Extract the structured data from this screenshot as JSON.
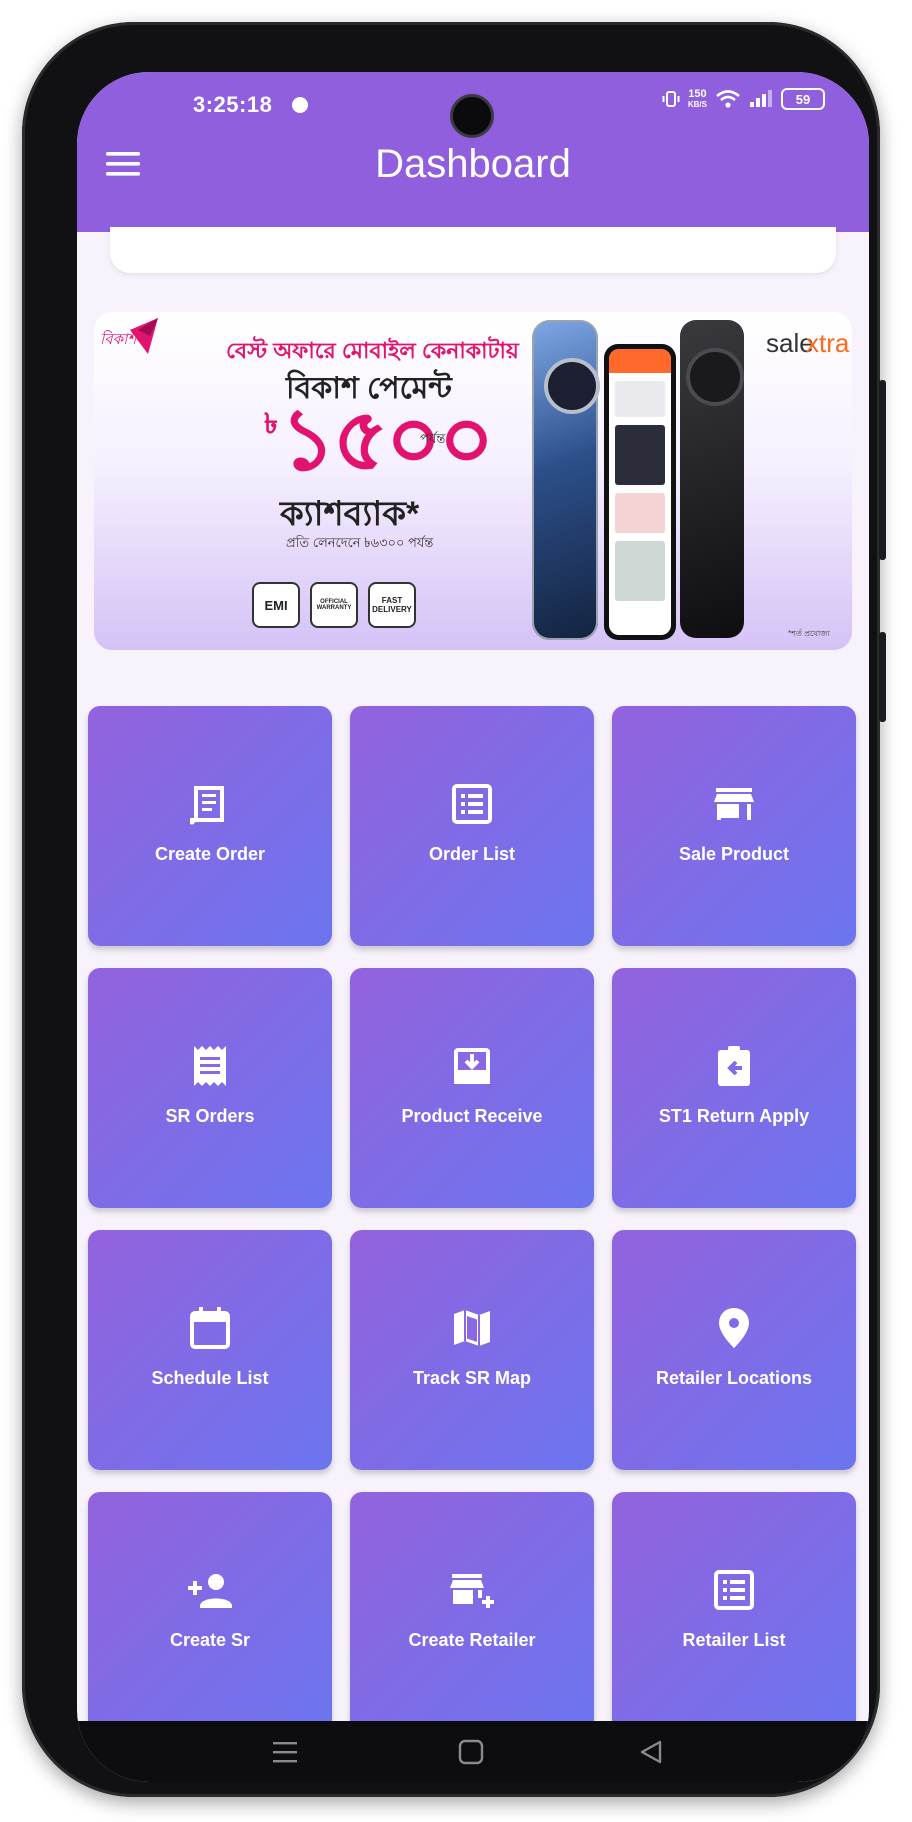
{
  "status_bar": {
    "time": "3:25:18",
    "net_speed_value": "150",
    "net_speed_unit": "KB/S",
    "battery": "59"
  },
  "app_bar": {
    "title": "Dashboard",
    "menu_icon": "hamburger-menu-icon"
  },
  "banner": {
    "brand_left": "বিকাশ",
    "line1": "বেস্ট অফারে মোবাইল কেনাকাটায়",
    "line2": "বিকাশ পেমেন্ট",
    "currency": "৳",
    "amount": "১৫০০",
    "amount_suffix": "পর্যন্ত",
    "line3": "ক্যাশব্যাক*",
    "line4": "প্রতি লেনদেনে ৳৬৩০০ পর্যন্ত",
    "badges": [
      "EMI",
      "OFFICIAL WARRANTY",
      "FAST DELIVERY"
    ],
    "brand_right_1": "sale",
    "brand_right_2": "xtra",
    "footnote": "*শর্ত প্রযোজ্য"
  },
  "tiles": [
    {
      "label": "Create Order",
      "icon": "receipt-icon"
    },
    {
      "label": "Order List",
      "icon": "list-alt-icon"
    },
    {
      "label": "Sale Product",
      "icon": "store-icon"
    },
    {
      "label": "SR Orders",
      "icon": "receipt-long-icon"
    },
    {
      "label": "Product Receive",
      "icon": "inbox-download-icon"
    },
    {
      "label": "ST1 Return Apply",
      "icon": "assignment-return-icon"
    },
    {
      "label": "Schedule List",
      "icon": "calendar-icon"
    },
    {
      "label": "Track SR Map",
      "icon": "map-icon"
    },
    {
      "label": "Retailer Locations",
      "icon": "location-pin-icon"
    },
    {
      "label": "Create Sr",
      "icon": "person-add-icon"
    },
    {
      "label": "Create Retailer",
      "icon": "add-business-icon"
    },
    {
      "label": "Retailer List",
      "icon": "list-alt-icon"
    }
  ],
  "nav_bar": {
    "buttons": [
      "menu-nav-icon",
      "home-nav-icon",
      "back-nav-icon"
    ]
  },
  "colors": {
    "app_bar": "#8f5fdd",
    "tile_start": "#9462dd",
    "tile_end": "#6b75ef",
    "screen_bg": "#f7f2fb",
    "banner_pink": "#e2136e"
  }
}
